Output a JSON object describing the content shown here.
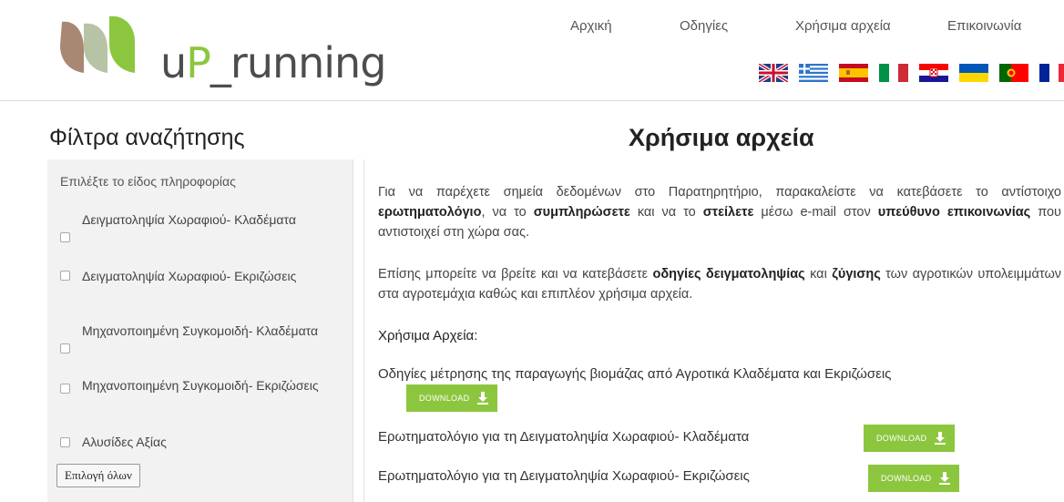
{
  "brand": {
    "logo_text_left": "u",
    "logo_text_p": "P",
    "logo_text_right": "_running"
  },
  "nav": [
    {
      "label": "Αρχική"
    },
    {
      "label": "Οδηγίες"
    },
    {
      "label": "Χρήσιμα αρχεία"
    },
    {
      "label": "Επικοινωνία"
    }
  ],
  "languages": [
    "uk-flag-icon",
    "greece-flag-icon",
    "spain-flag-icon",
    "italy-flag-icon",
    "croatia-flag-icon",
    "ukraine-flag-icon",
    "portugal-flag-icon",
    "france-flag-icon"
  ],
  "sidebar": {
    "title": "Φίλτρα αναζήτησης",
    "hint": "Επιλέξτε το είδος πληροφορίας",
    "options": [
      {
        "label": "Δειγματοληψία Χωραφιού- Κλαδέματα",
        "checked": false
      },
      {
        "label": "Δειγματοληψία Χωραφιού- Εκριζώσεις",
        "checked": false
      },
      {
        "label": "Μηχανοποιημένη Συγκομοιδή- Κλαδέματα",
        "checked": false
      },
      {
        "label": "Μηχανοποιημένη Συγκομοιδή- Εκριζώσεις",
        "checked": false
      },
      {
        "label": "Αλυσίδες Αξίας",
        "checked": false
      }
    ],
    "select_all_label": "Επιλογή όλων"
  },
  "main": {
    "title": "Χρήσιμα αρχεία",
    "p1": {
      "t1": "Για να παρέχετε σημεία δεδομένων στο Παρατηρητήριο, παρακαλείστε να κατεβάσετε το αντίστοιχο ",
      "b1": "ερωτηματολόγιο",
      "t2": ", να το ",
      "b2": "συμπληρώσετε",
      "t3": " και να το ",
      "b3": "στείλετε",
      "t4": " μέσω e-mail στον ",
      "b4": "υπεύθυνο επικοινωνίας",
      "t5": " που αντιστοιχεί στη χώρα σας."
    },
    "p2": {
      "t1": "Επίσης μπορείτε να βρείτε και να κατεβάσετε ",
      "b1": "οδηγίες δειγματοληψίας",
      "t2": " και ",
      "b2": "ζύγισης",
      "t3": " των αγροτικών υπολειμμάτων στα αγροτεμάχια καθώς και επιπλέον χρήσιμα αρχεία."
    },
    "subhead": "Χρήσιμα Αρχεία:",
    "files": [
      {
        "name": "Οδηγίες μέτρησης της παραγωγής βιομάζας από Αγροτικά Κλαδέματα και Εκριζώσεις",
        "button": "DOWNLOAD"
      },
      {
        "name": "Ερωτηματολόγιο για τη Δειγματοληψία Χωραφιού- Κλαδέματα",
        "button": "DOWNLOAD"
      },
      {
        "name": "Ερωτηματολόγιο για τη Δειγματοληψία Χωραφιού- Εκριζώσεις",
        "button": "DOWNLOAD"
      }
    ]
  },
  "colors": {
    "accent": "#8cc63f",
    "sidebar_bg": "#f2f2f2"
  }
}
